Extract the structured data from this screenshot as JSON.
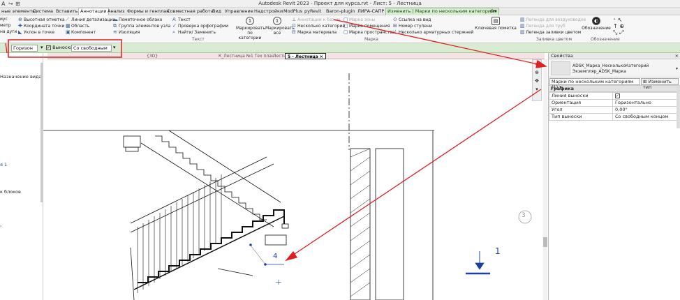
{
  "title_bar": {
    "title": "Autodesk Revit 2023 - Проект для курса.rvt - Лист: 5 - Лестница"
  },
  "ribbon_tabs": [
    "ные элементы",
    "Система",
    "Вставить",
    "Аннотации",
    "Анализ",
    "Формы и генплан",
    "Совместная работа",
    "Вид",
    "Управление",
    "Надстройки",
    "ModPlus",
    "pyRevit",
    "Baron-plugin",
    "ЛИРА-САПР",
    "Изменить | Марки по нескольким категориям"
  ],
  "ribbon": {
    "col1": [
      "иус",
      "метр",
      "на дуги"
    ],
    "col2": [
      "Высотная отметка",
      "Координата точки",
      "Уклон в точке"
    ],
    "col3": [
      "Линия детализации",
      "Область",
      "Компонент"
    ],
    "col4": [
      "Пометочное облако",
      "Группа элементов узла",
      "Изоляция"
    ],
    "col5": [
      "Текст",
      "Проверка орфографии",
      "Найти/ Заменить"
    ],
    "text_panel_label": "Текст",
    "tag_big_1": "Маркировать по категории",
    "tag_big_2": "Маркировать все",
    "col6": [
      "Аннотации к базам",
      "Несколько категорий",
      "Марка материала"
    ],
    "col7": [
      "Марка зоны",
      "Марка помещения",
      "Марка пространства"
    ],
    "col8": [
      "Ссылка на вид",
      "Номер ступени",
      "Несколько арматурных стержней"
    ],
    "tag_panel_label": "Марка",
    "keynote": "Ключевая пометка",
    "col9": [
      "Легенда для воздуховодов",
      "Легенда для труб",
      "Легенда заливки цветом"
    ],
    "color_fill_label": "Заливка цветом",
    "symbol": "Обозначение",
    "symbol_label": "Обозначение"
  },
  "options_bar": {
    "orientation": "Горизон",
    "leader_label": "Выноска",
    "leader_type": "Со свободным"
  },
  "view_tabs": {
    "tab1": "{3D}",
    "tab2": "К_Лестница №1 Тех план",
    "tab3": "Лестница",
    "active": "5 - Лестница"
  },
  "left_panel": {
    "item1": "Назначение вида",
    "item2": "я 1",
    "item3": "к блоков"
  },
  "properties": {
    "header": "Свойства",
    "type_name_1": "ADSK_Марка_НесколькоКатегорий",
    "type_name_2": "Экземпляр_ADSK_Марка",
    "instance_select": "Марки по нескольким категориям (1)",
    "edit_type": "Изменить тип",
    "group": "Графика",
    "rows": [
      {
        "key": "Линия выноски",
        "value": "☑"
      },
      {
        "key": "Ориентация",
        "value": "Горизонтально"
      },
      {
        "key": "Угол",
        "value": "0,00°"
      },
      {
        "key": "Тип выноски",
        "value": "Со свободным концом"
      }
    ]
  },
  "canvas": {
    "tag_number": "4",
    "grid_bubble": "3",
    "section_number": "1"
  }
}
